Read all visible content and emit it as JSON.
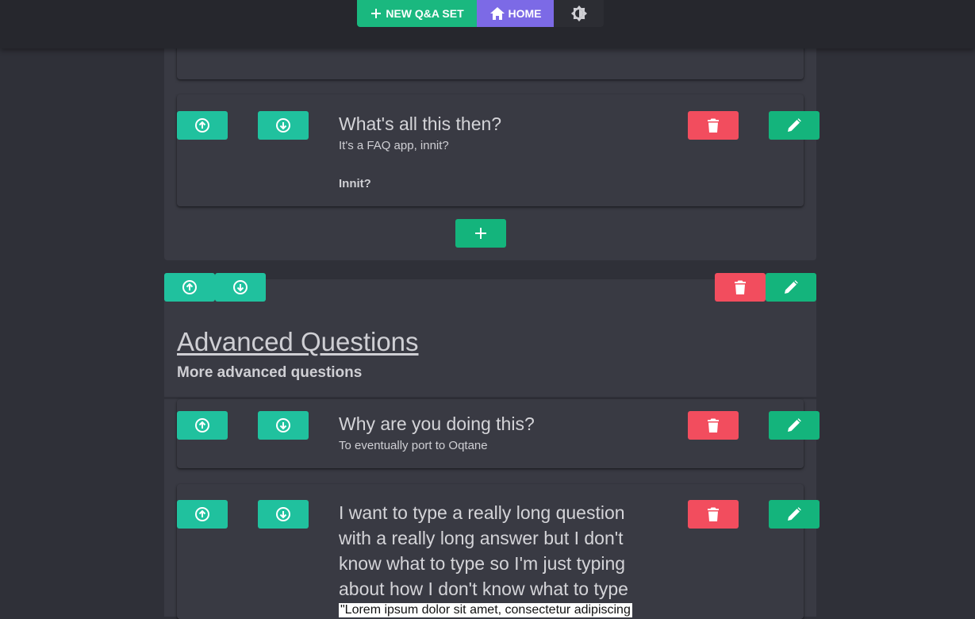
{
  "topbar": {
    "new_label": "NEW Q&A SET",
    "home_label": "HOME",
    "icons": [
      "plus-icon",
      "home-icon",
      "brightness-icon"
    ]
  },
  "colors": {
    "background": "#2f3038",
    "panel": "#393a43",
    "new_button": "#1ab87f",
    "home_button": "#7c6ae6",
    "move_button": "#20c19e",
    "delete_button": "#f24d5e",
    "edit_button": "#14b47c"
  },
  "set1": {
    "faqs": [
      {
        "question": "What's all this then?",
        "answer_line1": "It's a FAQ app, innit?",
        "answer_line2": "Innit?"
      }
    ]
  },
  "set2": {
    "title": "Advanced Questions",
    "description": "More advanced questions",
    "faqs": [
      {
        "question": "Why are you doing this?",
        "answer": "To eventually port to Oqtane"
      },
      {
        "question_lines": [
          "I want to type a really long question",
          "with a really long answer but I don't",
          "know what to type so I'm just typing",
          "about how I don't know what to type"
        ],
        "answer_start": "\"Lorem ipsum dolor sit amet, consectetur adipiscing"
      }
    ]
  }
}
